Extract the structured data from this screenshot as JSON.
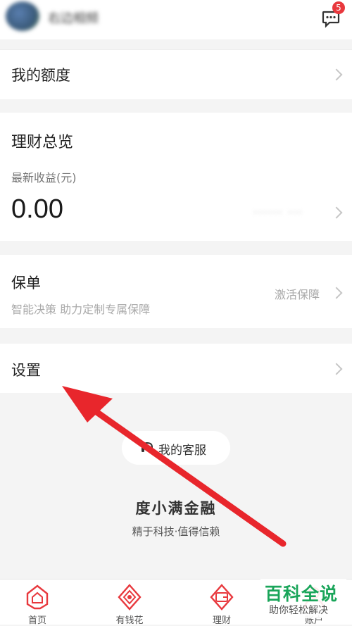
{
  "header": {
    "username": "右边相频",
    "message_badge": "5"
  },
  "sections": {
    "quota": {
      "label": "我的额度"
    },
    "finance": {
      "title": "理财总览",
      "subtitle": "最新收益(元)",
      "amount": "0.00",
      "hidden_value": "······ ···"
    },
    "insurance": {
      "title": "保单",
      "subtitle": "智能决策 助力定制专属保障",
      "action": "激活保障"
    },
    "settings": {
      "label": "设置"
    }
  },
  "support": {
    "button_label": "我的客服"
  },
  "brand": {
    "name": "度小满金融",
    "slogan": "精于科技·值得信赖"
  },
  "tabbar": [
    {
      "label": "首页",
      "icon": "home-icon"
    },
    {
      "label": "有钱花",
      "icon": "money-flower-icon"
    },
    {
      "label": "理财",
      "icon": "wallet-icon"
    },
    {
      "label": "账户",
      "icon": "account-icon"
    }
  ],
  "watermark": {
    "title": "百科全说",
    "subtitle": "助你轻松解决"
  },
  "colors": {
    "accent": "#e8383d",
    "arrow": "#e8262c",
    "background": "#f4f4f4"
  }
}
